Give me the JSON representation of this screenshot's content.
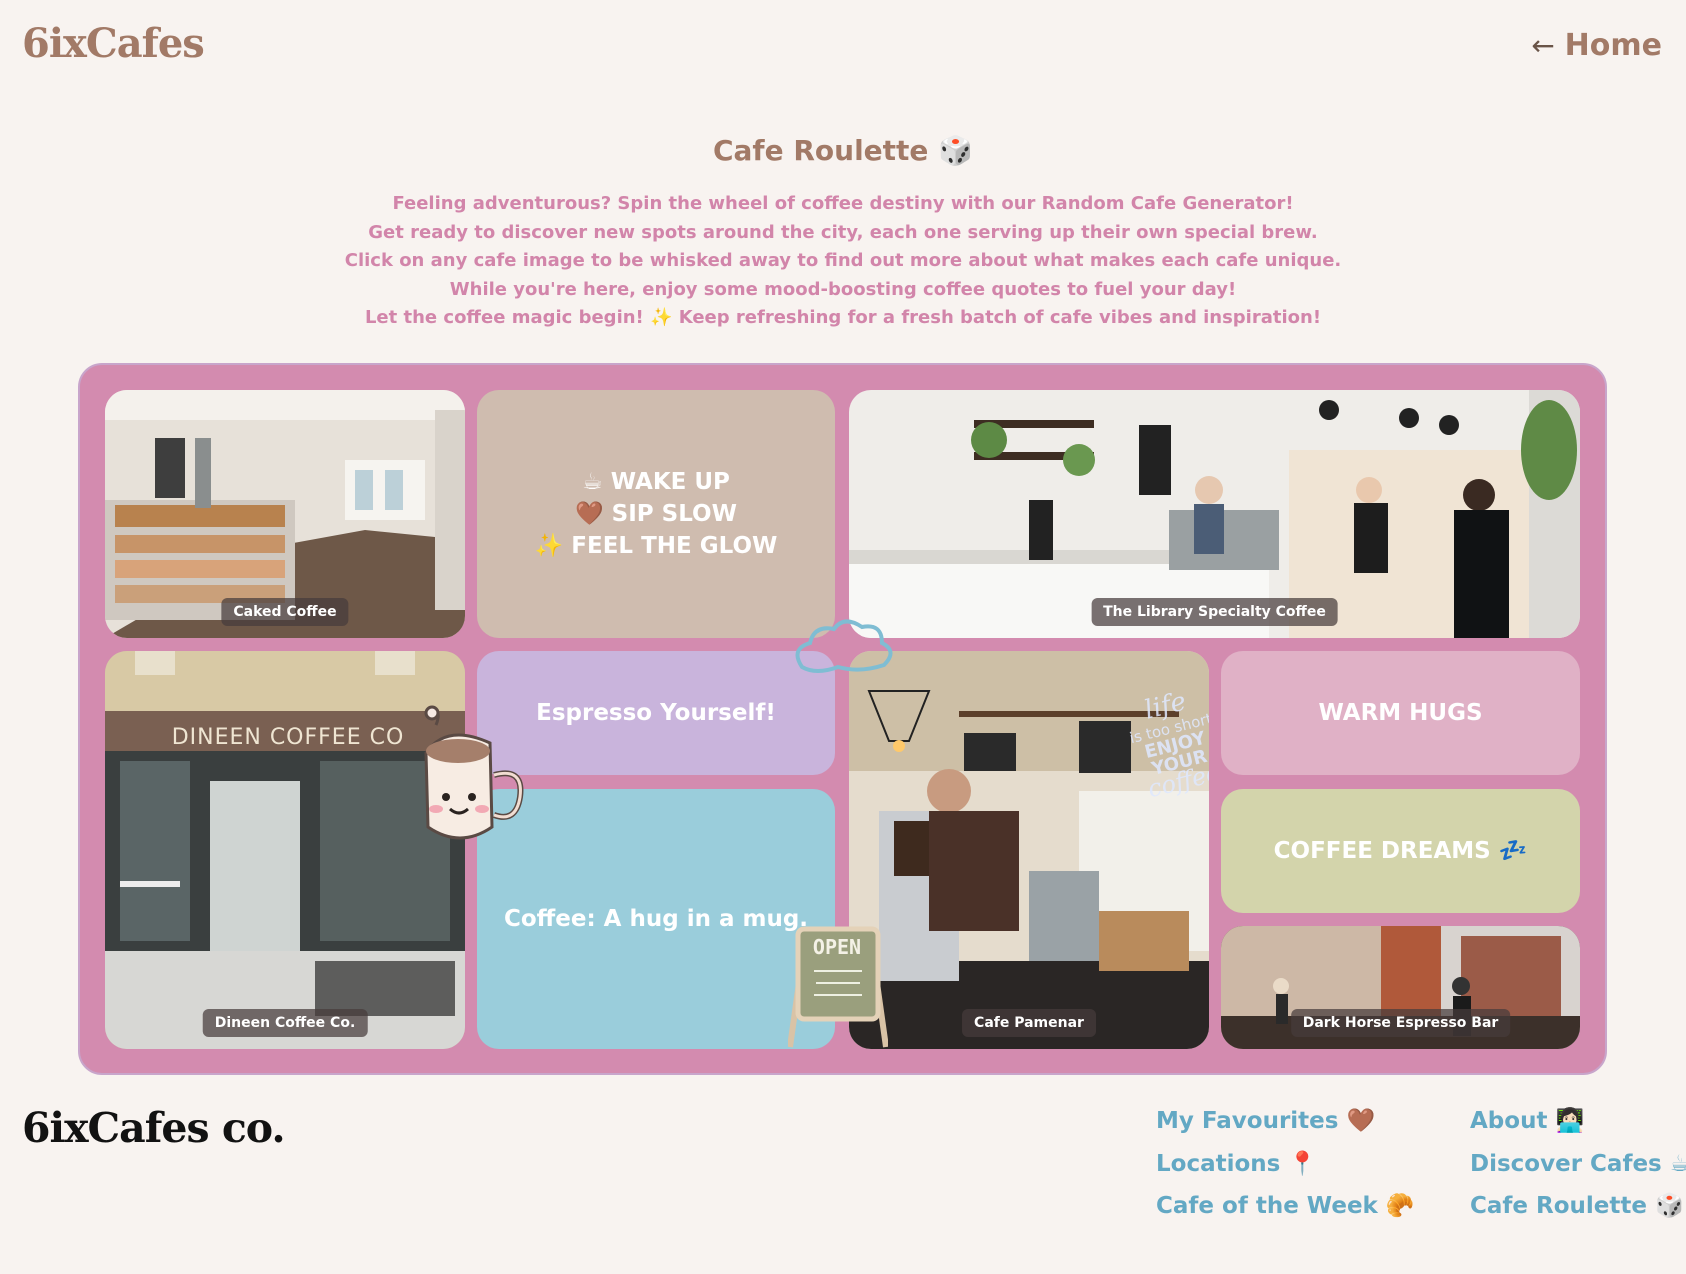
{
  "header": {
    "logo": "6ixCafes",
    "home_arrow": "←",
    "home_label": "Home"
  },
  "page": {
    "title": "Cafe Roulette 🎲",
    "intro_lines": [
      "Feeling adventurous? Spin the wheel of coffee destiny with our Random Cafe Generator!",
      "Get ready to discover new spots around the city, each one serving up their own special brew.",
      "Click on any cafe image to be whisked away to find out more about what makes each cafe unique.",
      "While you're here, enjoy some mood-boosting coffee quotes to fuel your day!",
      "Let the coffee magic begin! ✨ Keep refreshing for a fresh batch of cafe vibes and inspiration!"
    ]
  },
  "board": {
    "cafes": [
      {
        "name": "Caked Coffee"
      },
      {
        "name": "The Library Specialty Coffee"
      },
      {
        "name": "Dineen Coffee Co."
      },
      {
        "name": "Cafe Pamenar"
      },
      {
        "name": "Dark Horse Espresso Bar"
      }
    ],
    "quotes": {
      "wake_up_lines": [
        "☕ WAKE UP",
        "🤎 SIP SLOW",
        "✨ FEEL THE GLOW"
      ],
      "espresso": "Espresso Yourself!",
      "hug": "Coffee: A hug in a mug.",
      "warm_hugs": "WARM HUGS",
      "coffee_dreams": "COFFEE DREAMS 💤"
    },
    "signage": {
      "dineen_sign": "DINEEN COFFEE CO",
      "open_sign": "OPEN",
      "script_text": [
        "life",
        "is too short",
        "ENJOY YOUR",
        "coffee"
      ]
    },
    "colors": {
      "board": "#d38baf",
      "tan": "#cfbcaf",
      "lavender": "#c9b4dc",
      "blue": "#9acddb",
      "pink": "#e0b1c6",
      "olive": "#d3d4ab"
    }
  },
  "footer": {
    "logo": "6ixCafes co.",
    "links_col1": [
      "My Favourites 🤎",
      "Locations 📍",
      "Cafe of the Week 🥐"
    ],
    "links_col2": [
      "About 👩🏻‍💻",
      "Discover Cafes ☕",
      "Cafe Roulette 🎲"
    ]
  }
}
